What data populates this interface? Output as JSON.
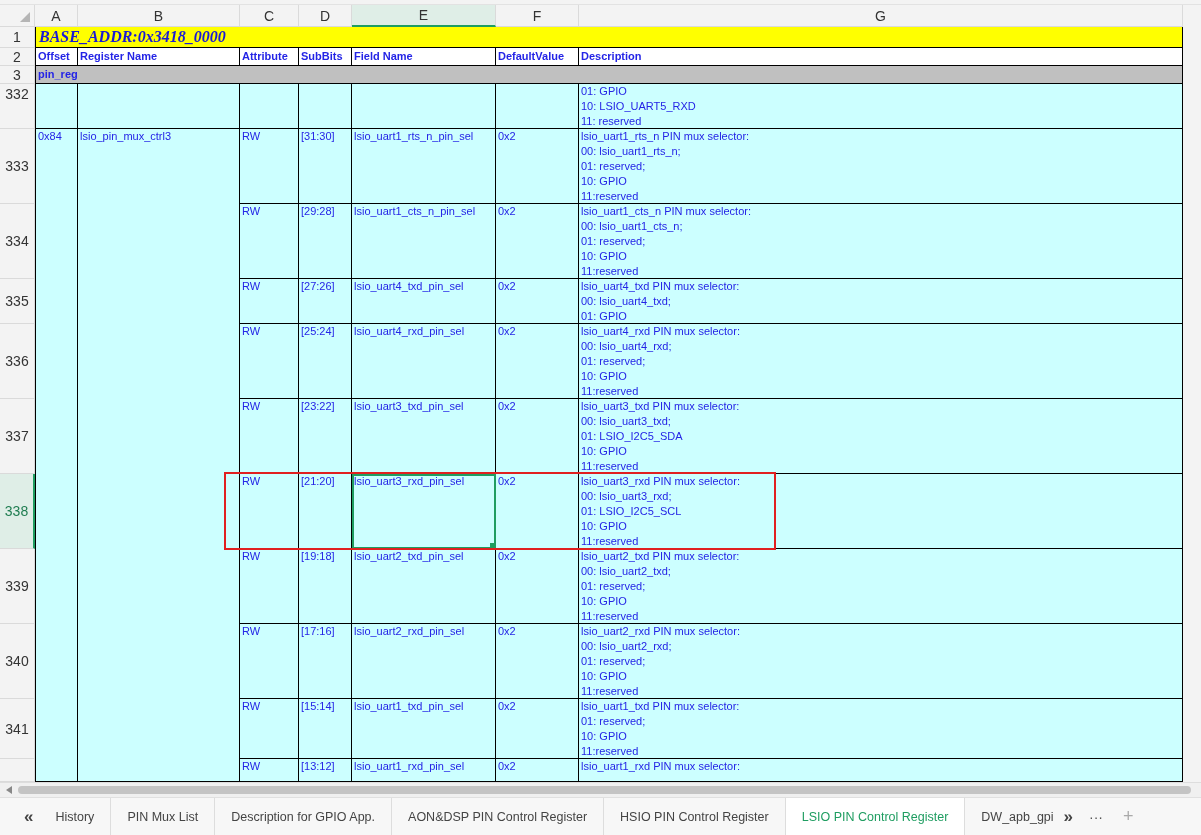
{
  "column_headers": [
    {
      "label": "A",
      "selected": false
    },
    {
      "label": "B",
      "selected": false
    },
    {
      "label": "C",
      "selected": false
    },
    {
      "label": "D",
      "selected": false
    },
    {
      "label": "E",
      "selected": true
    },
    {
      "label": "F",
      "selected": false
    },
    {
      "label": "G",
      "selected": false
    }
  ],
  "title_row": {
    "number": "1",
    "text": "BASE_ADDR:0x3418_0000"
  },
  "header_row": {
    "number": "2",
    "cells": [
      "Offset",
      "Register Name",
      "Attribute",
      "SubBits",
      "Field Name",
      "DefaultValue",
      "Description"
    ]
  },
  "section_row": {
    "number": "3",
    "text": "pin_reg"
  },
  "register": {
    "offset": "0x84",
    "name": "lsio_pin_mux_ctrl3"
  },
  "rows": [
    {
      "number": "332",
      "selected": false,
      "highlighted": false,
      "description": "01: GPIO\n10: LSIO_UART5_RXD\n11: reserved"
    },
    {
      "number": "333",
      "selected": false,
      "highlighted": false,
      "attribute": "RW",
      "subbits": "[31:30]",
      "field": "lsio_uart1_rts_n_pin_sel",
      "default": "0x2",
      "description": "lsio_uart1_rts_n PIN mux selector:\n00: lsio_uart1_rts_n;\n01: reserved;\n10: GPIO\n11:reserved"
    },
    {
      "number": "334",
      "selected": false,
      "highlighted": false,
      "attribute": "RW",
      "subbits": "[29:28]",
      "field": "lsio_uart1_cts_n_pin_sel",
      "default": "0x2",
      "description": "lsio_uart1_cts_n PIN mux selector:\n00: lsio_uart1_cts_n;\n01: reserved;\n10: GPIO\n11:reserved"
    },
    {
      "number": "335",
      "selected": false,
      "highlighted": false,
      "attribute": "RW",
      "subbits": "[27:26]",
      "field": "lsio_uart4_txd_pin_sel",
      "default": "0x2",
      "description": "lsio_uart4_txd PIN mux selector:\n00: lsio_uart4_txd;\n01: GPIO"
    },
    {
      "number": "336",
      "selected": false,
      "highlighted": false,
      "attribute": "RW",
      "subbits": "[25:24]",
      "field": "lsio_uart4_rxd_pin_sel",
      "default": "0x2",
      "description": "lsio_uart4_rxd PIN mux selector:\n00: lsio_uart4_rxd;\n01: reserved;\n10: GPIO\n11:reserved"
    },
    {
      "number": "337",
      "selected": false,
      "highlighted": false,
      "attribute": "RW",
      "subbits": "[23:22]",
      "field": "lsio_uart3_txd_pin_sel",
      "default": "0x2",
      "description": "lsio_uart3_txd PIN mux selector:\n00: lsio_uart3_txd;\n01: LSIO_I2C5_SDA\n10: GPIO\n11:reserved"
    },
    {
      "number": "338",
      "selected": true,
      "highlighted": true,
      "attribute": "RW",
      "subbits": "[21:20]",
      "field": "lsio_uart3_rxd_pin_sel",
      "default": "0x2",
      "description": "lsio_uart3_rxd PIN mux selector:\n00: lsio_uart3_rxd;\n01: LSIO_I2C5_SCL\n10: GPIO\n11:reserved"
    },
    {
      "number": "339",
      "selected": false,
      "highlighted": false,
      "attribute": "RW",
      "subbits": "[19:18]",
      "field": "lsio_uart2_txd_pin_sel",
      "default": "0x2",
      "description": "lsio_uart2_txd PIN mux selector:\n00: lsio_uart2_txd;\n01: reserved;\n10: GPIO\n11:reserved"
    },
    {
      "number": "340",
      "selected": false,
      "highlighted": false,
      "attribute": "RW",
      "subbits": "[17:16]",
      "field": "lsio_uart2_rxd_pin_sel",
      "default": "0x2",
      "description": "lsio_uart2_rxd PIN mux selector:\n00: lsio_uart2_rxd;\n01: reserved;\n10: GPIO\n11:reserved"
    },
    {
      "number": "341",
      "selected": false,
      "highlighted": false,
      "attribute": "RW",
      "subbits": "[15:14]",
      "field": "lsio_uart1_txd_pin_sel",
      "default": "0x2",
      "description": "lsio_uart1_txd PIN mux selector:\n01: reserved;\n10: GPIO\n11:reserved"
    },
    {
      "selected": false,
      "highlighted": false,
      "attribute": "RW",
      "subbits": "[13:12]",
      "field": "lsio_uart1_rxd_pin_sel",
      "default": "0x2",
      "description": "lsio_uart1_rxd PIN mux selector:"
    }
  ],
  "sheet_tabs": [
    {
      "label": "History",
      "selected": false
    },
    {
      "label": "PIN Mux List",
      "selected": false
    },
    {
      "label": "Description for GPIO App.",
      "selected": false
    },
    {
      "label": "AON&DSP PIN Control Register",
      "selected": false
    },
    {
      "label": "HSIO PIN Control Register",
      "selected": false
    },
    {
      "label": "LSIO PIN Control Register",
      "selected": true
    },
    {
      "label": "DW_apb_gpi",
      "selected": false
    }
  ],
  "tab_controls": {
    "previous": "«",
    "next": "»",
    "more": "···",
    "add": "+"
  }
}
